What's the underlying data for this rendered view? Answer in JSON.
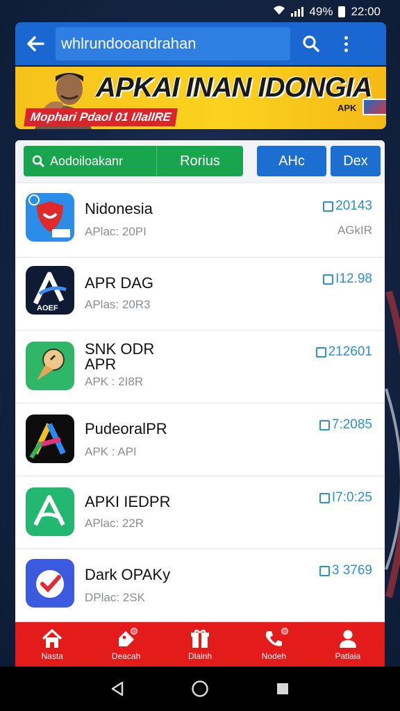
{
  "status_bar": {
    "battery": "49%",
    "time": "22:00"
  },
  "header": {
    "search_value": "whlrundooandrahan",
    "back_icon": "back-arrow-icon",
    "search_icon": "search-icon",
    "menu_icon": "more-vert-icon"
  },
  "banner": {
    "title": "APKAI INAN IDONGIA",
    "subtitle": "Mophari Pdaol 01 I/IalIRE",
    "badge": "APK"
  },
  "filters": [
    {
      "label": "Aodoiloakanr"
    },
    {
      "label": "Rorius"
    },
    {
      "label": "AHc"
    },
    {
      "label": "Dex"
    }
  ],
  "apps": [
    {
      "name": "Nidonesia",
      "meta": "APlac: 20PI",
      "date": "20143",
      "right_meta": "AGkIR",
      "icon": "shield-icon"
    },
    {
      "name": "APR DAG",
      "meta": "APlas: 20R3",
      "date": "I12.98",
      "right_meta": "",
      "icon": "letter-a-icon"
    },
    {
      "name": "SNK ODR\nAPR",
      "meta": "APK : 2I8R",
      "date": "212601",
      "right_meta": "",
      "icon": "ice-cream-icon"
    },
    {
      "name": "PudeoralPR",
      "meta": "APK : API",
      "date": "7:2085",
      "right_meta": "",
      "icon": "colorful-a-icon"
    },
    {
      "name": "APKI IEDPR",
      "meta": "APlac: 22R",
      "date": "I7:0:25",
      "right_meta": "",
      "icon": "outline-a-icon"
    },
    {
      "name": "Dark OPAKy",
      "meta": "DPlac: 2SK",
      "date": "3 3769",
      "right_meta": "",
      "icon": "check-heart-icon"
    }
  ],
  "bottom_nav": [
    {
      "label": "Nasta",
      "icon": "home-icon"
    },
    {
      "label": "Deacah",
      "icon": "tag-icon"
    },
    {
      "label": "Dlainh",
      "icon": "gift-icon"
    },
    {
      "label": "Nodeh",
      "icon": "phone-icon"
    },
    {
      "label": "Patlaia",
      "icon": "person-icon"
    }
  ],
  "system_nav": {
    "back": "back-triangle-icon",
    "home": "home-circle-icon",
    "recents": "recents-square-icon"
  },
  "colors": {
    "header_blue": "#1b67d1",
    "banner_yellow": "#f6c21a",
    "green": "#18a54d",
    "nav_red": "#e41b1b",
    "date_blue": "#2c8fd3"
  }
}
